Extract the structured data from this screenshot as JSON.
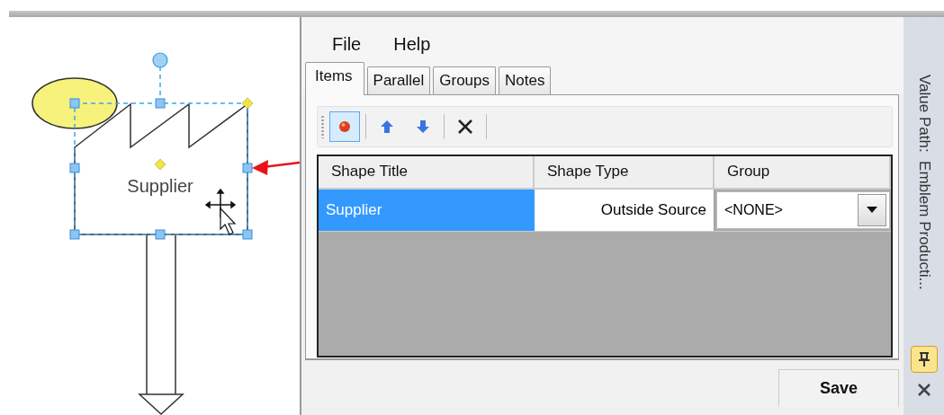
{
  "diagram": {
    "shape_label": "Supplier"
  },
  "panel": {
    "menu": [
      "File",
      "Help"
    ],
    "tabs": [
      {
        "label": "Items",
        "selected": true
      },
      {
        "label": "Parallel",
        "selected": false
      },
      {
        "label": "Groups",
        "selected": false
      },
      {
        "label": "Notes",
        "selected": false
      }
    ],
    "toolbar": [
      {
        "kind": "record",
        "pressed": true
      },
      {
        "kind": "up",
        "pressed": false
      },
      {
        "kind": "down",
        "pressed": false
      },
      {
        "kind": "delete",
        "pressed": false
      }
    ],
    "table": {
      "columns": [
        "Shape Title",
        "Shape Type",
        "Group"
      ],
      "rows": [
        {
          "shape_title": "Supplier",
          "shape_type": "Outside Source",
          "group": "<NONE>",
          "selected": true
        }
      ]
    },
    "save_button": "Save"
  },
  "side_tab": {
    "label": "Value Path:  Emblem Producti...",
    "pinned": true
  }
}
